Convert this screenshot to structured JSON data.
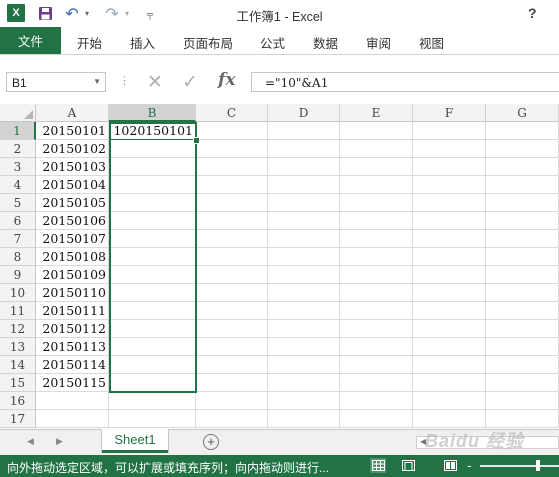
{
  "window": {
    "title": "工作簿1 - Excel",
    "help": "?"
  },
  "qat": {
    "app_icon": "X",
    "save_icon": "save-icon",
    "undo_glyph": "↶",
    "redo_glyph": "↷",
    "dropdown_glyph": "▾",
    "customize_glyph": "╤"
  },
  "ribbon": {
    "file_tab": "文件",
    "tabs": [
      "开始",
      "插入",
      "页面布局",
      "公式",
      "数据",
      "审阅",
      "视图"
    ]
  },
  "formula_bar": {
    "name_box": "B1",
    "cancel": "✕",
    "enter": "✓",
    "fx": "fx",
    "formula": "=\"10\"&A1"
  },
  "columns": [
    "A",
    "B",
    "C",
    "D",
    "E",
    "F",
    "G"
  ],
  "selected_column": "B",
  "rows": [
    {
      "n": "1",
      "a": "20150101",
      "b": "1020150101"
    },
    {
      "n": "2",
      "a": "20150102",
      "b": ""
    },
    {
      "n": "3",
      "a": "20150103",
      "b": ""
    },
    {
      "n": "4",
      "a": "20150104",
      "b": ""
    },
    {
      "n": "5",
      "a": "20150105",
      "b": ""
    },
    {
      "n": "6",
      "a": "20150106",
      "b": ""
    },
    {
      "n": "7",
      "a": "20150107",
      "b": ""
    },
    {
      "n": "8",
      "a": "20150108",
      "b": ""
    },
    {
      "n": "9",
      "a": "20150109",
      "b": ""
    },
    {
      "n": "10",
      "a": "20150110",
      "b": ""
    },
    {
      "n": "11",
      "a": "20150111",
      "b": ""
    },
    {
      "n": "12",
      "a": "20150112",
      "b": ""
    },
    {
      "n": "13",
      "a": "20150113",
      "b": ""
    },
    {
      "n": "14",
      "a": "20150114",
      "b": ""
    },
    {
      "n": "15",
      "a": "20150115",
      "b": ""
    },
    {
      "n": "16",
      "a": "",
      "b": ""
    },
    {
      "n": "17",
      "a": "",
      "b": ""
    }
  ],
  "selected_row": "1",
  "sheets": {
    "tabs": [
      "Sheet1"
    ],
    "active": "Sheet1",
    "add": "+",
    "prev": "◀",
    "next": "▶"
  },
  "status": {
    "message": "向外拖动选定区域，可以扩展或填充序列；向内拖动则进行...",
    "zoom_minus": "-"
  },
  "watermark": "Baidu 经验",
  "colors": {
    "accent": "#217346",
    "header_bg": "#f3f3f3",
    "selected_header_bg": "#d3d3d3",
    "gridline": "#dadada"
  }
}
